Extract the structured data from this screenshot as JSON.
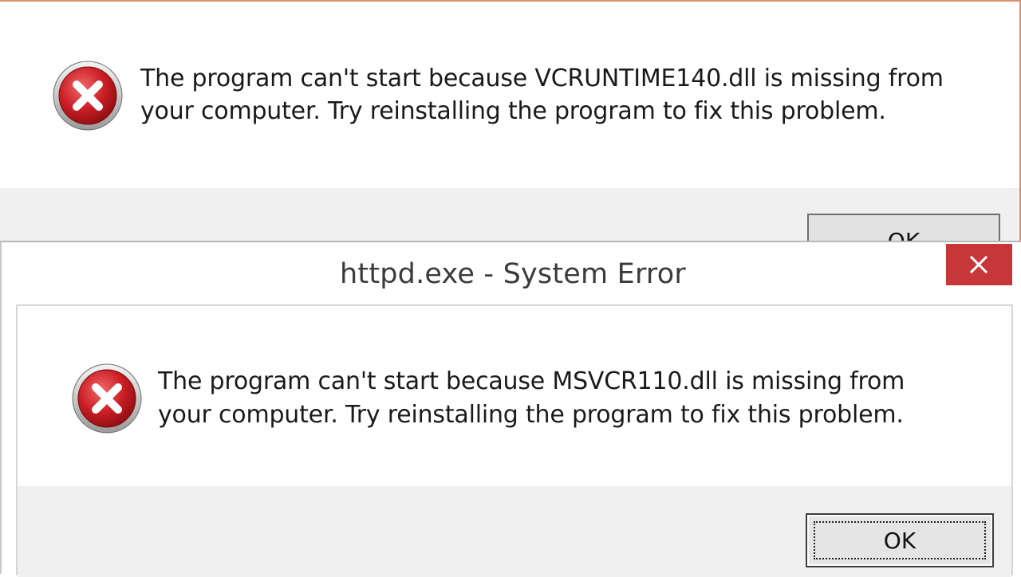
{
  "back_dialog": {
    "message": "The program can't start because VCRUNTIME140.dll is missing from your computer. Try reinstalling the program to fix this problem.",
    "ok_label": "OK",
    "icon": "error-icon"
  },
  "front_dialog": {
    "title": "httpd.exe - System Error",
    "close_icon": "close-icon",
    "message": "The program can't start because MSVCR110.dll is missing from your computer. Try reinstalling the program to fix this problem.",
    "ok_label": "OK",
    "icon": "error-icon"
  },
  "colors": {
    "close_button": "#c7373a",
    "error_red": "#c4161c",
    "footer_bg": "#f0f0f0"
  }
}
